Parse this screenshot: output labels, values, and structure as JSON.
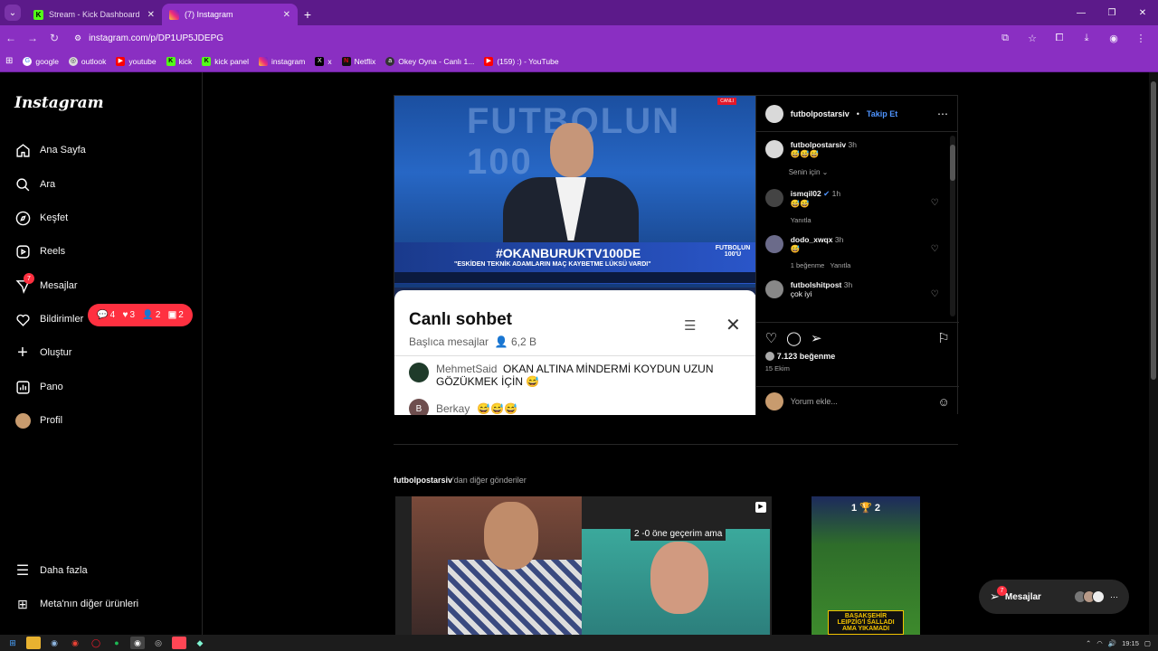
{
  "browser": {
    "tabs": [
      {
        "label": "Stream - Kick Dashboard",
        "active": false,
        "favicon_color": "#53fc18"
      },
      {
        "label": "(7) Instagram",
        "active": true,
        "favicon_color": "#e1306c"
      }
    ],
    "url": "instagram.com/p/DP1UP5JDEPG",
    "bookmarks": [
      {
        "label": "google",
        "icon": "google-icon"
      },
      {
        "label": "outlook",
        "icon": "outlook-icon"
      },
      {
        "label": "youtube",
        "icon": "youtube-icon"
      },
      {
        "label": "kick",
        "icon": "kick-icon"
      },
      {
        "label": "kick panel",
        "icon": "kick-icon"
      },
      {
        "label": "instagram",
        "icon": "instagram-icon"
      },
      {
        "label": "x",
        "icon": "x-icon"
      },
      {
        "label": "Netflix",
        "icon": "netflix-icon"
      },
      {
        "label": "Okey Oyna - Canlı 1...",
        "icon": "okey-icon"
      },
      {
        "label": "(159) :) - YouTube",
        "icon": "youtube-icon"
      }
    ],
    "accent_color": "#8a2fc2"
  },
  "sidebar": {
    "logo": "Instagram",
    "items": [
      {
        "label": "Ana Sayfa",
        "icon": "home-icon"
      },
      {
        "label": "Ara",
        "icon": "search-icon"
      },
      {
        "label": "Keşfet",
        "icon": "compass-icon"
      },
      {
        "label": "Reels",
        "icon": "reels-icon"
      },
      {
        "label": "Mesajlar",
        "icon": "messenger-icon",
        "badge": "7"
      },
      {
        "label": "Bildirimler",
        "icon": "heart-icon"
      },
      {
        "label": "Oluştur",
        "icon": "plus-icon"
      },
      {
        "label": "Pano",
        "icon": "dashboard-icon"
      },
      {
        "label": "Profil",
        "icon": "avatar"
      }
    ],
    "bottom": [
      {
        "label": "Daha fazla",
        "icon": "menu-icon"
      },
      {
        "label": "Meta'nın diğer ürünleri",
        "icon": "meta-products-icon"
      }
    ],
    "notifications": {
      "comments": "4",
      "likes": "3",
      "follows": "2",
      "requests": "2"
    }
  },
  "post": {
    "username": "futbolpostarsiv",
    "follow_label": "Takip Et",
    "separator": "•",
    "media": {
      "tv_hashtag": "#OKANBURUKTV100DE",
      "tv_subtitle": "\"ESKİDEN TEKNİK ADAMLARIN MAÇ KAYBETME LÜKSÜ VARDI\"",
      "tv_channel": "FUTBOLUN 100'Ü",
      "tv_live": "CANLI",
      "tv_bg_text": "FUTBOLUN 100",
      "chat_title": "Canlı sohbet",
      "chat_subtitle": "Başlıca mesajlar",
      "chat_viewers": "6,2 B",
      "messages": [
        {
          "name": "MehmetSaid",
          "text": "OKAN ALTINA MİNDERMİ KOYDUN UZUN GÖZÜKMEK İÇİN 😅"
        },
        {
          "name": "Berkay",
          "text": "😅😅😅"
        }
      ]
    },
    "caption": {
      "user": "futbolpostarsiv",
      "time": "3h",
      "text": "😅😅😅"
    },
    "for_you_label": "Senin için",
    "comments": [
      {
        "user": "ismqil02",
        "verified": true,
        "time": "1h",
        "text": "😅😅",
        "likes": "",
        "reply": "Yanıtla"
      },
      {
        "user": "dodo_xwqx",
        "verified": false,
        "time": "3h",
        "text": "😅",
        "likes": "1 beğenme",
        "reply": "Yanıtla"
      },
      {
        "user": "futbolshitpost",
        "verified": false,
        "time": "3h",
        "text": "çok iyi",
        "likes": "",
        "reply": ""
      }
    ],
    "likes": "7.123 beğenme",
    "date": "15 Ekim",
    "comment_placeholder": "Yorum ekle..."
  },
  "more_posts": {
    "user": "futbolpostarsiv",
    "suffix": "'dan diğer gönderiler",
    "thumb1_caption": "2 -0 öne geçerim ama",
    "thumb2_score": "1  🏆  2",
    "thumb2_caption": "BAŞAKŞEHİR LEIPZIG'İ SALLADI AMA YIKAMADI"
  },
  "messages_float": {
    "label": "Mesajlar",
    "badge": "7"
  },
  "taskbar": {
    "time": "19:15"
  }
}
